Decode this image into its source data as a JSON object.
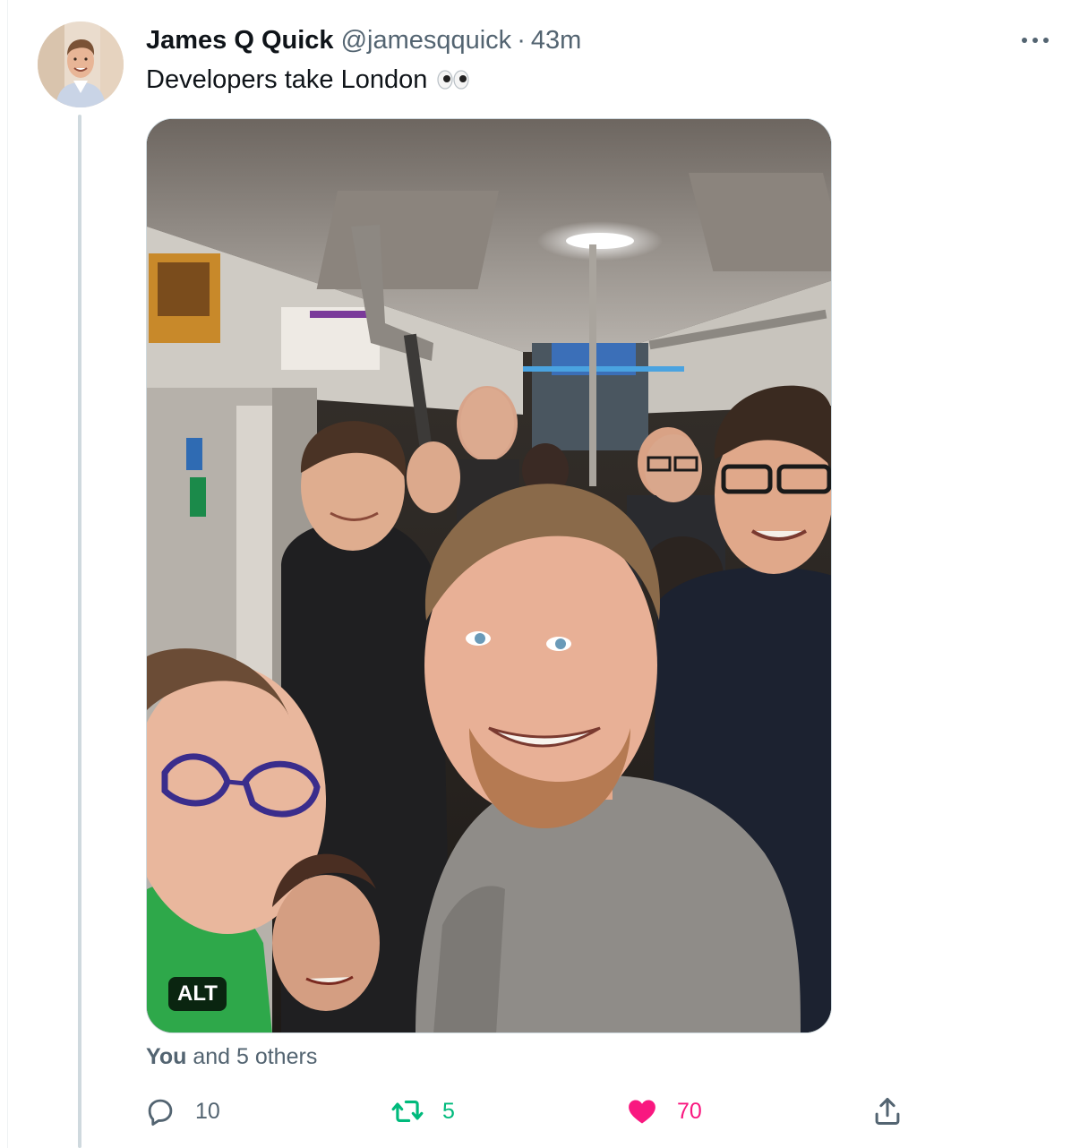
{
  "tweet": {
    "author_name": "James Q Quick",
    "handle": "@jamesqquick",
    "separator": "·",
    "time": "43m",
    "text": "Developers take London"
  },
  "media": {
    "alt_label": "ALT"
  },
  "liked_by": {
    "you": "You",
    "rest": "and 5 others"
  },
  "actions": {
    "reply_count": "10",
    "retweet_count": "5",
    "like_count": "70"
  },
  "colors": {
    "text_primary": "#0f1419",
    "text_secondary": "#536471",
    "retweet_active": "#00ba7c",
    "like_active": "#f91880",
    "thread_line": "#cfd9de"
  },
  "icons": [
    "more-icon",
    "eyes-emoji-icon",
    "reply-icon",
    "retweet-icon",
    "like-heart-icon",
    "share-icon"
  ]
}
